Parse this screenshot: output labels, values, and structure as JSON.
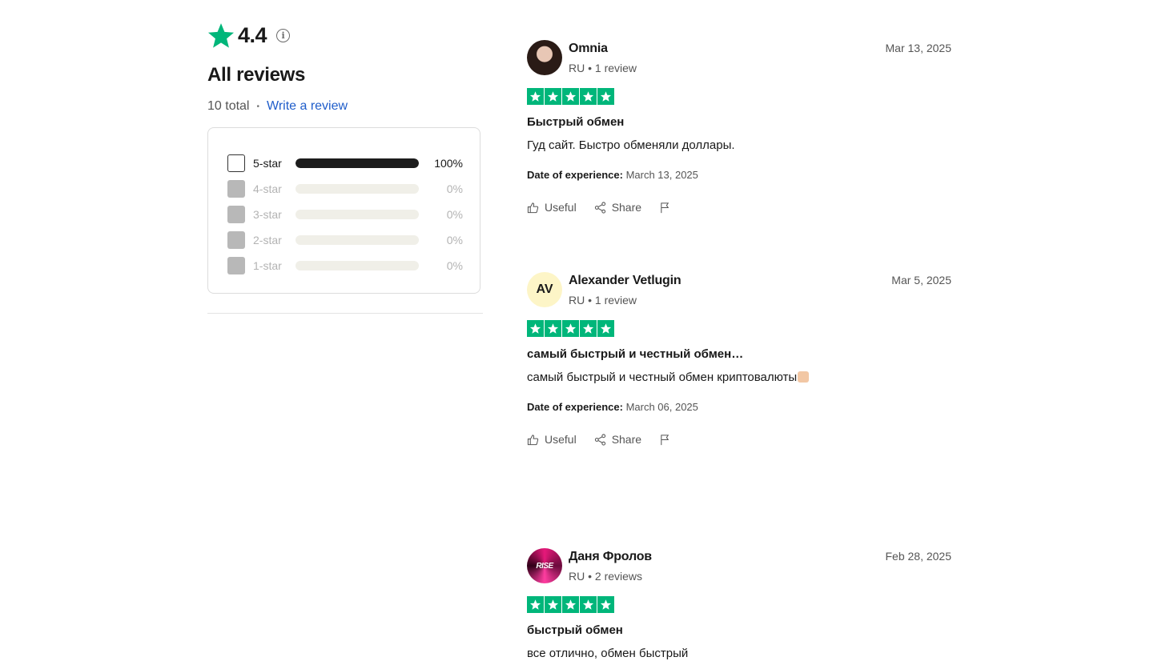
{
  "summary": {
    "rating": "4.4",
    "heading": "All reviews",
    "total": "10 total",
    "separator": "•",
    "write_review": "Write a review",
    "info_icon": "i",
    "filters": [
      {
        "label": "5-star",
        "percent": "100%",
        "fill": 1.0,
        "enabled": true
      },
      {
        "label": "4-star",
        "percent": "0%",
        "fill": 0.0,
        "enabled": false
      },
      {
        "label": "3-star",
        "percent": "0%",
        "fill": 0.0,
        "enabled": false
      },
      {
        "label": "2-star",
        "percent": "0%",
        "fill": 0.0,
        "enabled": false
      },
      {
        "label": "1-star",
        "percent": "0%",
        "fill": 0.0,
        "enabled": false
      }
    ]
  },
  "reviews": [
    {
      "name": "Omnia",
      "meta": "RU • 1 review",
      "date": "Mar 13, 2025",
      "stars": 5,
      "title": "Быстрый обмен",
      "text": "Гуд сайт. Быстро обменяли доллары.",
      "exp_label": "Date of experience:",
      "exp_date": "March 13, 2025",
      "avatar": "photo"
    },
    {
      "name": "Alexander Vetlugin",
      "meta": "RU • 1 review",
      "date": "Mar 5, 2025",
      "stars": 5,
      "title": "самый быстрый и честный обмен…",
      "text": "самый быстрый и честный обмен криптовалюты",
      "exp_label": "Date of experience:",
      "exp_date": "March 06, 2025",
      "avatar": "initials",
      "initials": "AV"
    },
    {
      "name": "Даня Фролов",
      "meta": "RU • 2 reviews",
      "date": "Feb 28, 2025",
      "stars": 5,
      "title": "быстрый обмен",
      "text": "все отлично, обмен быстрый",
      "avatar": "art",
      "avatar_text": "RISE"
    }
  ],
  "actions": {
    "useful": "Useful",
    "share": "Share"
  },
  "colors": {
    "trustpilot_green": "#00b67a",
    "link_blue": "#1f5dca"
  },
  "icons": [
    "star-icon",
    "info-icon",
    "thumbs-up-icon",
    "share-icon",
    "flag-icon"
  ]
}
